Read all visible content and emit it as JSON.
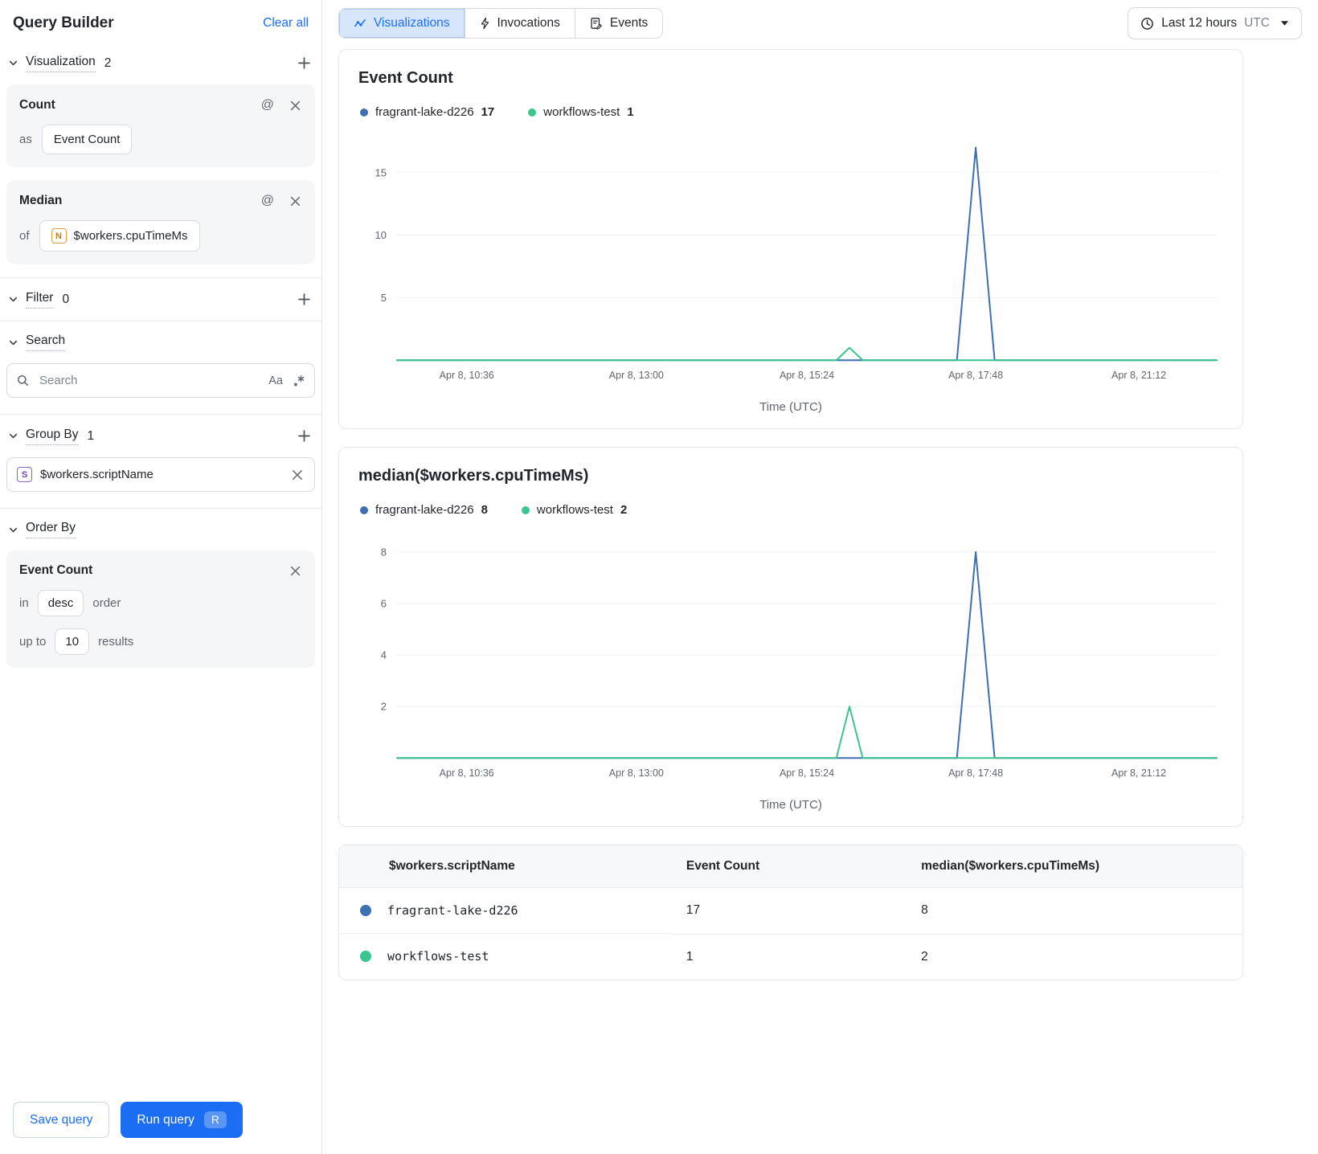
{
  "colors": {
    "accent_blue": "#1b6ef3",
    "series_blue": "#3d6fb2",
    "series_green": "#3cc58e",
    "tab_active_bg": "#d7e6fd"
  },
  "sidebar": {
    "title": "Query Builder",
    "clear_all_label": "Clear all",
    "visualization_section": {
      "label": "Visualization",
      "count": "2",
      "cards": [
        {
          "title": "Count",
          "row_prefix": "as",
          "value": "Event Count"
        },
        {
          "title": "Median",
          "row_prefix": "of",
          "type_badge": "N",
          "value": "$workers.cpuTimeMs"
        }
      ]
    },
    "filter_section": {
      "label": "Filter",
      "count": "0"
    },
    "search_section": {
      "label": "Search",
      "placeholder": "Search",
      "match_case_icon": "Aa"
    },
    "group_by_section": {
      "label": "Group By",
      "count": "1",
      "items": [
        {
          "type_badge": "S",
          "value": "$workers.scriptName"
        }
      ]
    },
    "order_by_section": {
      "label": "Order By",
      "card": {
        "title": "Event Count",
        "in_label": "in",
        "direction": "desc",
        "order_label": "order",
        "up_to_label": "up to",
        "limit": "10",
        "results_label": "results"
      }
    },
    "save_query_label": "Save query",
    "run_query_label": "Run query",
    "run_query_shortcut": "R"
  },
  "topbar": {
    "tabs": [
      {
        "label": "Visualizations",
        "active": true
      },
      {
        "label": "Invocations",
        "active": false
      },
      {
        "label": "Events",
        "active": false
      }
    ],
    "time_range": {
      "label": "Last 12 hours",
      "timezone": "UTC"
    }
  },
  "chart_data": [
    {
      "type": "line",
      "title": "Event Count",
      "xlabel": "Time (UTC)",
      "ylim": [
        0,
        17.5
      ],
      "yticks": [
        5,
        10,
        15
      ],
      "grid": "horizontal",
      "legend_position": "top",
      "xticks": [
        {
          "label": "Apr 8, 10:36",
          "f": 0.085
        },
        {
          "label": "Apr 8, 13:00",
          "f": 0.292
        },
        {
          "label": "Apr 8, 15:24",
          "f": 0.5
        },
        {
          "label": "Apr 8, 17:48",
          "f": 0.706
        },
        {
          "label": "Apr 8, 21:12",
          "f": 0.905
        }
      ],
      "series": [
        {
          "name": "fragrant-lake-d226",
          "total": "17",
          "color": "#3d6fb2",
          "points": [
            [
              0,
              0
            ],
            [
              0.683,
              0
            ],
            [
              0.706,
              17
            ],
            [
              0.729,
              0
            ],
            [
              1,
              0
            ]
          ]
        },
        {
          "name": "workflows-test",
          "total": "1",
          "color": "#3cc58e",
          "points": [
            [
              0,
              0
            ],
            [
              0.536,
              0
            ],
            [
              0.552,
              1
            ],
            [
              0.568,
              0
            ],
            [
              1,
              0
            ]
          ]
        }
      ]
    },
    {
      "type": "line",
      "title": "median($workers.cpuTimeMs)",
      "xlabel": "Time (UTC)",
      "ylim": [
        0,
        8.5
      ],
      "yticks": [
        2,
        4,
        6,
        8
      ],
      "grid": "horizontal",
      "legend_position": "top",
      "xticks": [
        {
          "label": "Apr 8, 10:36",
          "f": 0.085
        },
        {
          "label": "Apr 8, 13:00",
          "f": 0.292
        },
        {
          "label": "Apr 8, 15:24",
          "f": 0.5
        },
        {
          "label": "Apr 8, 17:48",
          "f": 0.706
        },
        {
          "label": "Apr 8, 21:12",
          "f": 0.905
        }
      ],
      "series": [
        {
          "name": "fragrant-lake-d226",
          "total": "8",
          "color": "#3d6fb2",
          "points": [
            [
              0,
              0
            ],
            [
              0.683,
              0
            ],
            [
              0.706,
              8
            ],
            [
              0.729,
              0
            ],
            [
              1,
              0
            ]
          ]
        },
        {
          "name": "workflows-test",
          "total": "2",
          "color": "#3cc58e",
          "points": [
            [
              0,
              0
            ],
            [
              0.536,
              0
            ],
            [
              0.552,
              2
            ],
            [
              0.568,
              0
            ],
            [
              1,
              0
            ]
          ]
        }
      ]
    }
  ],
  "table": {
    "headers": [
      "$workers.scriptName",
      "Event Count",
      "median($workers.cpuTimeMs)"
    ],
    "rows": [
      {
        "color": "#3d6fb2",
        "script_name": "fragrant-lake-d226",
        "event_count": "17",
        "median": "8"
      },
      {
        "color": "#3cc58e",
        "script_name": "workflows-test",
        "event_count": "1",
        "median": "2"
      }
    ]
  }
}
